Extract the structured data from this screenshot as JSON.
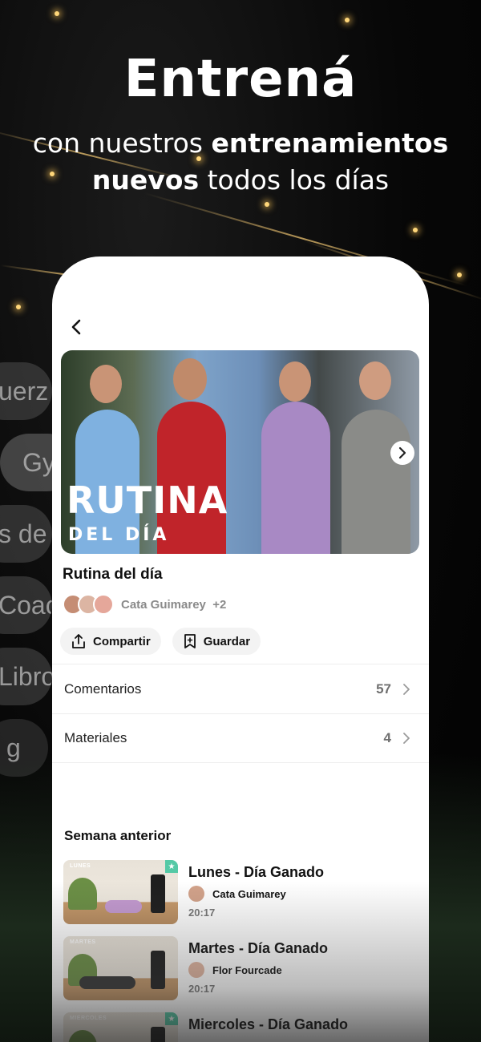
{
  "promo": {
    "headline": "Entrená",
    "sub_pre": "con nuestros ",
    "sub_bold1": "entrenamientos",
    "sub_bold2": "nuevos",
    "sub_post": " todos los días"
  },
  "background_pills": [
    "uerz",
    "Gy",
    "s de",
    "Coach",
    "Libro",
    "g"
  ],
  "screen": {
    "hero": {
      "title_big": "RUTINA",
      "title_small": "DEL DÍA"
    },
    "workout_title": "Rutina del día",
    "authors": "Cata Guimarey",
    "authors_more": "+2",
    "share_label": "Compartir",
    "save_label": "Guardar",
    "rows": [
      {
        "label": "Comentarios",
        "count": "57"
      },
      {
        "label": "Materiales",
        "count": "4"
      }
    ],
    "section_title": "Semana anterior",
    "items": [
      {
        "tag": "LUNES",
        "name": "Lunes - Día Ganado",
        "coach": "Cata Guimarey",
        "time": "20:17"
      },
      {
        "tag": "MARTES",
        "name": "Martes - Día Ganado",
        "coach": "Flor Fourcade",
        "time": "20:17"
      },
      {
        "tag": "MIERCOLES",
        "name": "Miercoles - Día Ganado",
        "coach": "",
        "time": ""
      }
    ]
  },
  "colors": {
    "accent_star": "#55c9a6",
    "background": "#050505"
  },
  "icons": [
    "chevron-left-icon",
    "chevron-right-icon",
    "share-icon",
    "bookmark-icon",
    "star-icon"
  ]
}
